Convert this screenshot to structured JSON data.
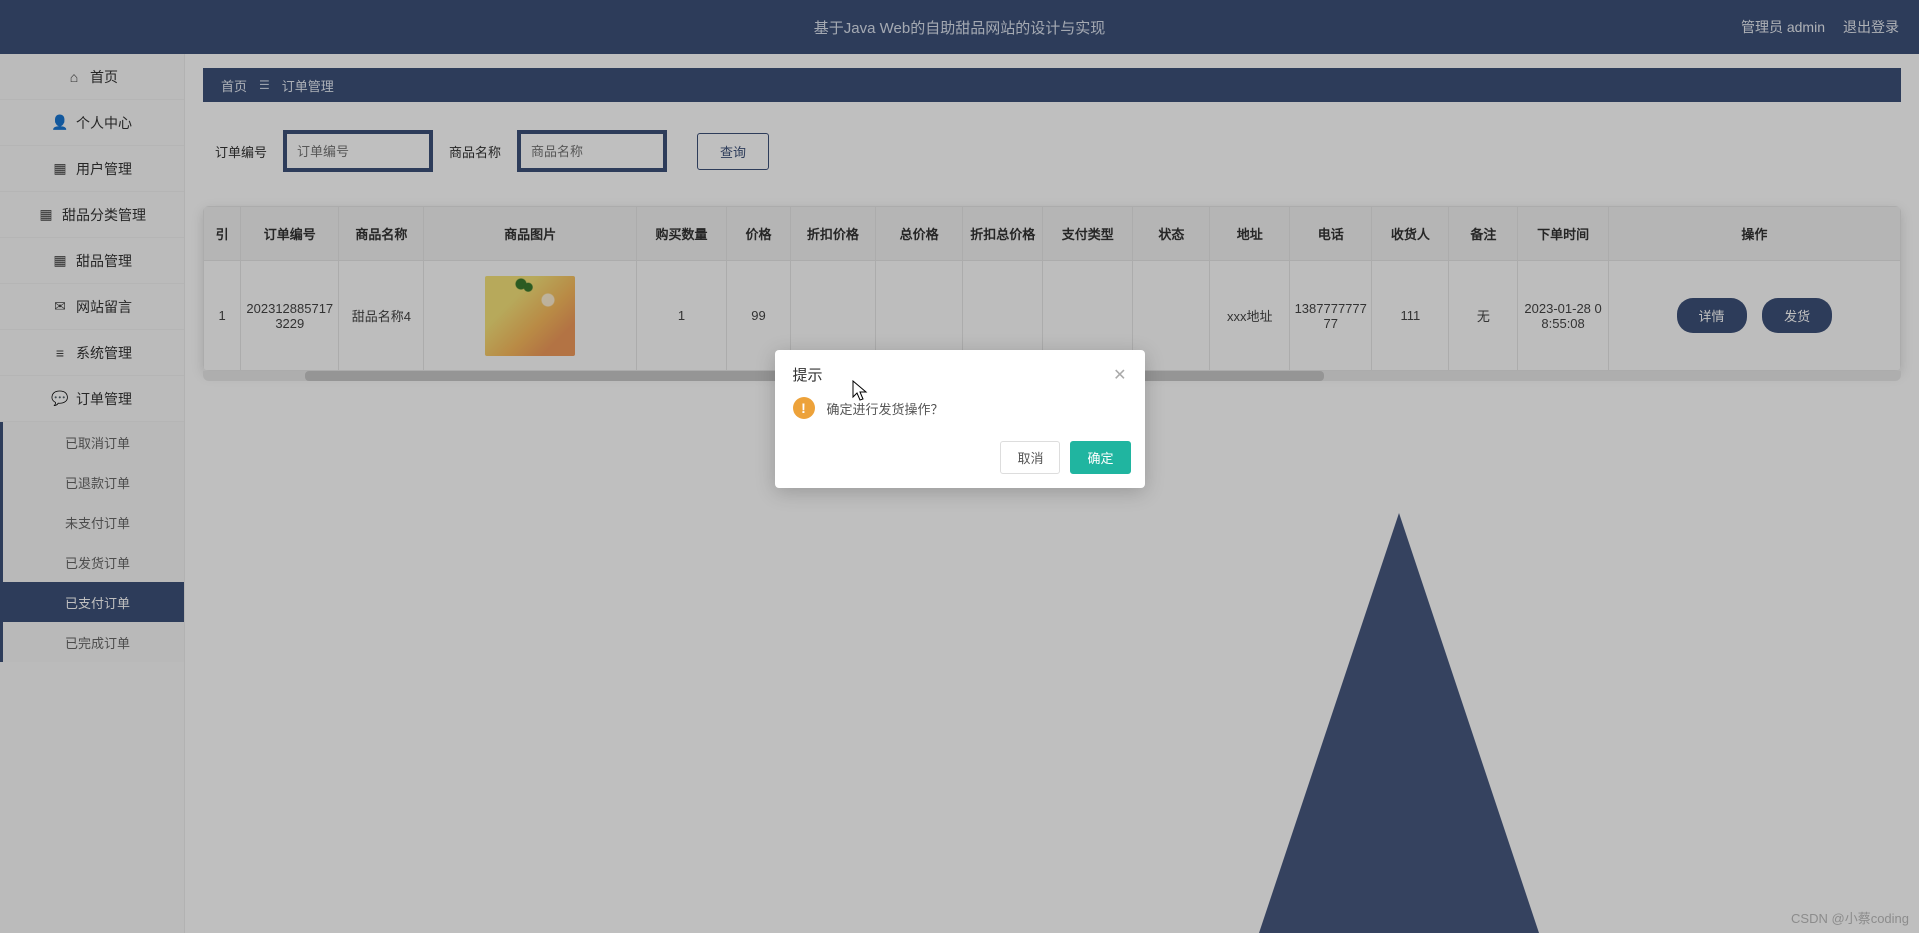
{
  "topbar": {
    "title": "基于Java Web的自助甜品网站的设计与实现",
    "admin_label": "管理员 admin",
    "logout_label": "退出登录"
  },
  "nav": {
    "items": [
      {
        "label": "首页",
        "icon": "home-icon"
      },
      {
        "label": "个人中心",
        "icon": "user-icon"
      },
      {
        "label": "用户管理",
        "icon": "grid-icon"
      },
      {
        "label": "甜品分类管理",
        "icon": "grid-icon"
      },
      {
        "label": "甜品管理",
        "icon": "grid-icon"
      },
      {
        "label": "网站留言",
        "icon": "message-icon"
      },
      {
        "label": "系统管理",
        "icon": "list-icon"
      },
      {
        "label": "订单管理",
        "icon": "chat-icon"
      }
    ],
    "sub_items": [
      {
        "label": "已取消订单"
      },
      {
        "label": "已退款订单"
      },
      {
        "label": "未支付订单"
      },
      {
        "label": "已发货订单"
      },
      {
        "label": "已支付订单",
        "active": true
      },
      {
        "label": "已完成订单"
      }
    ]
  },
  "breadcrumb": {
    "home": "首页",
    "current": "订单管理"
  },
  "search": {
    "label_order": "订单编号",
    "ph_order": "订单编号",
    "label_product": "商品名称",
    "ph_product": "商品名称",
    "btn": "查询"
  },
  "table": {
    "headers": {
      "idx": "引",
      "order_no": "订单编号",
      "product": "商品名称",
      "image": "商品图片",
      "qty": "购买数量",
      "price": "价格",
      "discount_price": "折扣价格",
      "total": "总价格",
      "discount_total": "折扣总价格",
      "pay_type": "支付类型",
      "status": "状态",
      "addr": "地址",
      "tel": "电话",
      "receiver": "收货人",
      "note": "备注",
      "time": "下单时间",
      "ops": "操作"
    },
    "row": {
      "idx": "1",
      "order_no": "2023128857173229",
      "product": "甜品名称4",
      "qty": "1",
      "price": "99",
      "discount_price": "",
      "total": "",
      "discount_total": "",
      "pay_type": "",
      "status": "",
      "addr": "xxx地址",
      "tel": "138777777777",
      "receiver": "111",
      "note": "无",
      "time": "2023-01-28 08:55:08",
      "ops": {
        "detail": "详情",
        "ship": "发货"
      }
    }
  },
  "dialog": {
    "title": "提示",
    "message": "确定进行发货操作？",
    "cancel": "取消",
    "confirm": "确定"
  },
  "watermark": "CSDN @小蔡coding"
}
